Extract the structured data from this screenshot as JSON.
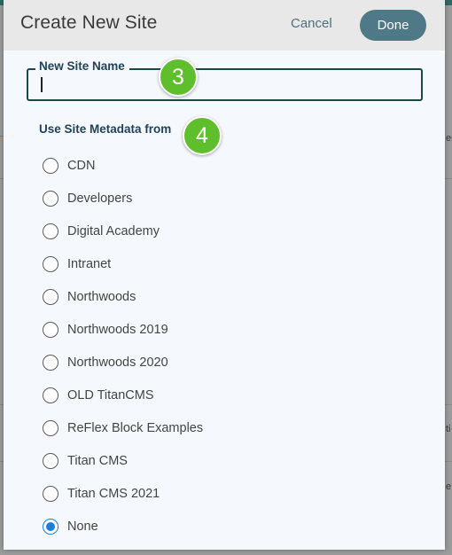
{
  "dialog": {
    "title": "Create New Site",
    "cancel_label": "Cancel",
    "done_label": "Done"
  },
  "site_name": {
    "legend": "New Site Name",
    "value": "",
    "step": "3"
  },
  "metadata": {
    "label": "Use Site Metadata from",
    "step": "4",
    "selected": "None",
    "options": [
      "CDN",
      "Developers",
      "Digital Academy",
      "Intranet",
      "Northwoods",
      "Northwoods 2019",
      "Northwoods 2020",
      "OLD TitanCMS",
      "ReFlex Block Examples",
      "Titan CMS",
      "Titan CMS 2021",
      "None"
    ]
  },
  "colors": {
    "done_button": "#4f7987",
    "step_badge": "#5fbe2c",
    "radio_selected": "#1c7ed6"
  }
}
